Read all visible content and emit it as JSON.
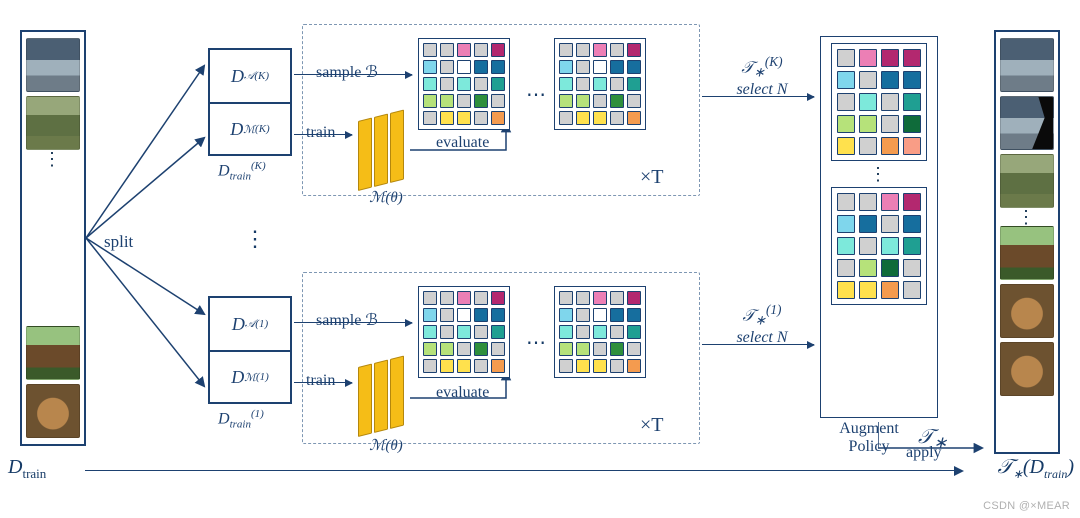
{
  "left_label_html": "D<span class='sub'>train</span>",
  "right_label_html": "𝒯<sub style='font-size:12px'>∗</sub>(D<sub style='font-size:12px'>train</sub>)",
  "split": "split",
  "dpair": {
    "k": {
      "top_html": "D<span class='supb'></span>",
      "a_html": "D<sub class='subm'>𝒜</sub><sup class='sup'>(K)</sup>",
      "m_html": "D<sub class='subm'>ℳ</sub><sup class='sup'>(K)</sup>",
      "cap_html": "D<sub class='subm'>train</sub><sup class='sup'>(K)</sup>"
    },
    "o": {
      "a_html": "D<sub class='subm'>𝒜</sub><sup class='sup'>(1)</sup>",
      "m_html": "D<sub class='subm'>ℳ</sub><sup class='sup'>(1)</sup>",
      "cap_html": "D<sub class='subm'>train</sub><sup class='sup'>(1)</sup>"
    }
  },
  "labels": {
    "sampleB": "sample ℬ",
    "train": "train",
    "evaluate": "evaluate",
    "timesT": "×T",
    "select_k_html": "𝒯<sub>∗</sub><sup>(K)</sup><br>select N",
    "select_1_html": "𝒯<sub>∗</sub><sup>(1)</sup><br>select N",
    "model_html": "ℳ(θ)",
    "augment_policy": "Augment\nPolicy",
    "policy_sym_html": "𝒯<sub>∗</sub>",
    "apply": "apply"
  },
  "grid_colors": [
    [
      "c-gr",
      "c-gr",
      "c-pk",
      "c-gr",
      "c-mg"
    ],
    [
      "c-lb",
      "c-gr",
      "c-wh",
      "c-bl",
      "c-bl"
    ],
    [
      "c-cy",
      "c-gr",
      "c-cy",
      "c-gr",
      "c-tl"
    ],
    [
      "c-lg",
      "c-lg",
      "c-gr",
      "c-gn",
      "c-gr"
    ],
    [
      "c-gr",
      "c-yl",
      "c-yl",
      "c-gr",
      "c-or"
    ]
  ],
  "policy_colors_a": [
    [
      "c-gr",
      "c-pk",
      "c-mg",
      "c-mg"
    ],
    [
      "c-lb",
      "c-gr",
      "c-bl",
      "c-bl"
    ],
    [
      "c-gr",
      "c-cy",
      "c-gr",
      "c-tl"
    ],
    [
      "c-lg",
      "c-lg",
      "c-gr",
      "c-dg"
    ],
    [
      "c-yl",
      "c-gr",
      "c-or",
      "c-sal"
    ]
  ],
  "policy_colors_b": [
    [
      "c-gr",
      "c-gr",
      "c-pk",
      "c-mg"
    ],
    [
      "c-lb",
      "c-bl",
      "c-gr",
      "c-bl"
    ],
    [
      "c-cy",
      "c-gr",
      "c-cy",
      "c-tl"
    ],
    [
      "c-gr",
      "c-lg",
      "c-dg",
      "c-gr"
    ],
    [
      "c-yl",
      "c-yl",
      "c-or",
      "c-gr"
    ]
  ],
  "watermark": "CSDN @×MEAR"
}
